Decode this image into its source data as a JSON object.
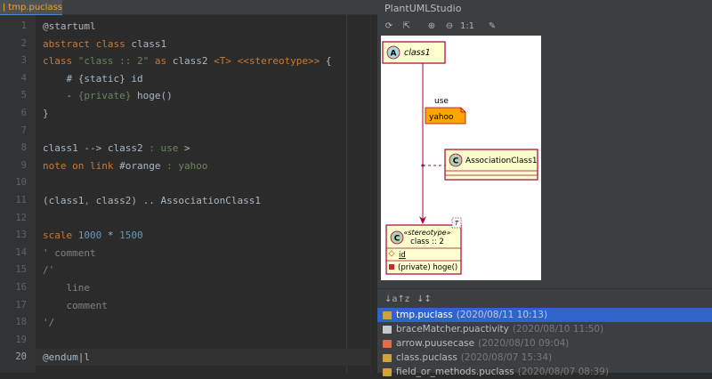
{
  "editor": {
    "tab_label": "tmp.puclass",
    "lines": [
      {
        "num": "1",
        "tokens": [
          {
            "t": "@startuml",
            "c": "pl"
          }
        ]
      },
      {
        "num": "2",
        "tokens": [
          {
            "t": "abstract class ",
            "c": "kw"
          },
          {
            "t": "class1",
            "c": "pl"
          }
        ]
      },
      {
        "num": "3",
        "tokens": [
          {
            "t": "class ",
            "c": "kw"
          },
          {
            "t": "\"class :: 2\"",
            "c": "str"
          },
          {
            "t": " as ",
            "c": "kw"
          },
          {
            "t": "class2 ",
            "c": "pl"
          },
          {
            "t": "<T> <<stereotype>>",
            "c": "kw"
          },
          {
            "t": " {",
            "c": "pl"
          }
        ]
      },
      {
        "num": "4",
        "tokens": [
          {
            "t": "    # ",
            "c": "pl"
          },
          {
            "t": "{static}",
            "c": "pl"
          },
          {
            "t": " id",
            "c": "pl"
          }
        ]
      },
      {
        "num": "5",
        "tokens": [
          {
            "t": "    - ",
            "c": "pl"
          },
          {
            "t": "{private}",
            "c": "str"
          },
          {
            "t": " hoge()",
            "c": "pl"
          }
        ]
      },
      {
        "num": "6",
        "tokens": [
          {
            "t": "}",
            "c": "pl"
          }
        ]
      },
      {
        "num": "7",
        "tokens": []
      },
      {
        "num": "8",
        "tokens": [
          {
            "t": "class1 --> class2 ",
            "c": "pl"
          },
          {
            "t": ": use",
            "c": "str"
          },
          {
            "t": " >",
            "c": "pl"
          }
        ]
      },
      {
        "num": "9",
        "tokens": [
          {
            "t": "note on link ",
            "c": "kw"
          },
          {
            "t": "#orange",
            "c": "pl"
          },
          {
            "t": " : yahoo",
            "c": "str"
          }
        ]
      },
      {
        "num": "10",
        "tokens": []
      },
      {
        "num": "11",
        "tokens": [
          {
            "t": "(class1",
            "c": "pl"
          },
          {
            "t": ",",
            "c": "kw"
          },
          {
            "t": " class2) .. AssociationClass1",
            "c": "pl"
          }
        ]
      },
      {
        "num": "12",
        "tokens": []
      },
      {
        "num": "13",
        "tokens": [
          {
            "t": "scale ",
            "c": "kw"
          },
          {
            "t": "1000",
            "c": "num"
          },
          {
            "t": " * ",
            "c": "pl"
          },
          {
            "t": "1500",
            "c": "num"
          }
        ]
      },
      {
        "num": "14",
        "tokens": [
          {
            "t": "' comment",
            "c": "cm"
          }
        ]
      },
      {
        "num": "15",
        "tokens": [
          {
            "t": "/'",
            "c": "cm"
          }
        ]
      },
      {
        "num": "16",
        "tokens": [
          {
            "t": "    line",
            "c": "cm"
          }
        ]
      },
      {
        "num": "17",
        "tokens": [
          {
            "t": "    comment",
            "c": "cm"
          }
        ]
      },
      {
        "num": "18",
        "tokens": [
          {
            "t": "'/",
            "c": "cm"
          }
        ]
      },
      {
        "num": "19",
        "tokens": []
      },
      {
        "num": "20",
        "tokens": [
          {
            "t": "@endum|l",
            "c": "pl"
          }
        ],
        "current": true
      }
    ]
  },
  "studio": {
    "title": "PlantUMLStudio",
    "toolbar": [
      {
        "name": "refresh-icon",
        "glyph": "⟳"
      },
      {
        "name": "export-icon",
        "glyph": "⇱"
      },
      {
        "name": "zoom-in-icon",
        "glyph": "⊕"
      },
      {
        "name": "zoom-out-icon",
        "glyph": "⊖"
      },
      {
        "name": "actual-size-icon",
        "glyph": "1:1"
      },
      {
        "name": "settings-icon",
        "glyph": "✎"
      }
    ],
    "diagram": {
      "class1_name": "class1",
      "class1_marker": "A",
      "link_label": "use",
      "note_text": "yahoo",
      "assoc_name": "AssociationClass1",
      "assoc_marker": "C",
      "class2_marker": "C",
      "class2_stereotype": "«stereotype»",
      "class2_name": "class :: 2",
      "class2_generic": "T",
      "class2_field": "id",
      "class2_method": "(private) hoge()"
    },
    "sort_buttons": [
      "↓a↑z",
      "↓↕"
    ],
    "history": [
      {
        "name": "tmp.puclass",
        "date": "(2020/08/11 10:13)",
        "color": "#d2a23a",
        "selected": true
      },
      {
        "name": "braceMatcher.puactivity",
        "date": "(2020/08/10 11:50)",
        "color": "#c8c8c8",
        "selected": false
      },
      {
        "name": "arrow.puusecase",
        "date": "(2020/08/10 09:04)",
        "color": "#e06c4a",
        "selected": false
      },
      {
        "name": "class.puclass",
        "date": "(2020/08/07 15:34)",
        "color": "#d2a23a",
        "selected": false
      },
      {
        "name": "field_or_methods.puclass",
        "date": "(2020/08/07 08:39)",
        "color": "#d2a23a",
        "selected": false
      }
    ]
  },
  "colors": {
    "accent": "#2f65ca",
    "keyword": "#cc7832",
    "string": "#6a8759",
    "number": "#6897bb",
    "note": "#ffa500",
    "arrow": "#a80036",
    "class_fill": "#fefece"
  }
}
